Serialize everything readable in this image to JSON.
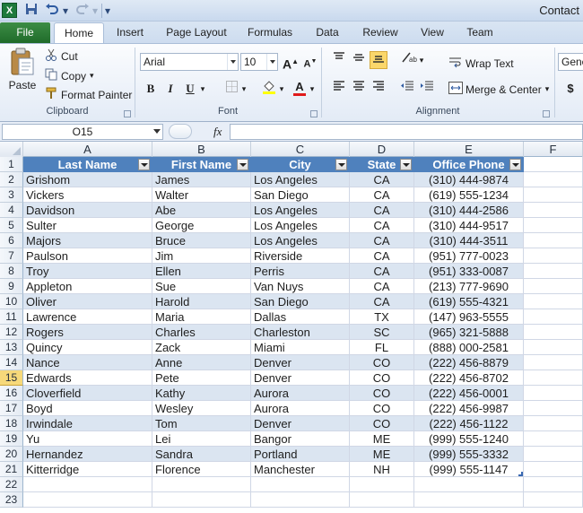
{
  "window": {
    "app_icon": "X",
    "title": "Contact"
  },
  "tabs": [
    "File",
    "Home",
    "Insert",
    "Page Layout",
    "Formulas",
    "Data",
    "Review",
    "View",
    "Team"
  ],
  "ribbon": {
    "clipboard": {
      "paste": "Paste",
      "cut": "Cut",
      "copy": "Copy",
      "format_painter": "Format Painter",
      "label": "Clipboard"
    },
    "font": {
      "name": "Arial",
      "size": "10",
      "bold": "B",
      "italic": "I",
      "underline": "U",
      "grow": "A",
      "shrink": "A",
      "font_color_letter": "A",
      "label": "Font"
    },
    "alignment": {
      "wrap_text": "Wrap Text",
      "merge_center": "Merge & Center",
      "label": "Alignment"
    },
    "number": {
      "format": "Gene",
      "currency": "$"
    }
  },
  "formula_bar": {
    "name_box": "O15",
    "fx": "fx",
    "formula": ""
  },
  "columns": [
    "A",
    "B",
    "C",
    "D",
    "E",
    "F"
  ],
  "row_numbers": [
    "1",
    "2",
    "3",
    "4",
    "5",
    "6",
    "7",
    "8",
    "9",
    "10",
    "11",
    "12",
    "13",
    "14",
    "15",
    "16",
    "17",
    "18",
    "19",
    "20",
    "21",
    "22",
    "23"
  ],
  "selected_row": "15",
  "table": {
    "headers": [
      "Last Name",
      "First Name",
      "City",
      "State",
      "Office Phone"
    ],
    "rows": [
      [
        "Grishom",
        "James",
        "Los Angeles",
        "CA",
        "(310) 444-9874"
      ],
      [
        "Vickers",
        "Walter",
        "San Diego",
        "CA",
        "(619) 555-1234"
      ],
      [
        "Davidson",
        "Abe",
        "Los Angeles",
        "CA",
        "(310) 444-2586"
      ],
      [
        "Sulter",
        "George",
        "Los Angeles",
        "CA",
        "(310) 444-9517"
      ],
      [
        "Majors",
        "Bruce",
        "Los Angeles",
        "CA",
        "(310) 444-3511"
      ],
      [
        "Paulson",
        "Jim",
        "Riverside",
        "CA",
        "(951) 777-0023"
      ],
      [
        "Troy",
        "Ellen",
        "Perris",
        "CA",
        "(951) 333-0087"
      ],
      [
        "Appleton",
        "Sue",
        "Van Nuys",
        "CA",
        "(213) 777-9690"
      ],
      [
        "Oliver",
        "Harold",
        "San Diego",
        "CA",
        "(619) 555-4321"
      ],
      [
        "Lawrence",
        "Maria",
        "Dallas",
        "TX",
        "(147) 963-5555"
      ],
      [
        "Rogers",
        "Charles",
        "Charleston",
        "SC",
        "(965) 321-5888"
      ],
      [
        "Quincy",
        "Zack",
        "Miami",
        "FL",
        "(888) 000-2581"
      ],
      [
        "Nance",
        "Anne",
        "Denver",
        "CO",
        "(222) 456-8879"
      ],
      [
        "Edwards",
        "Pete",
        "Denver",
        "CO",
        "(222) 456-8702"
      ],
      [
        "Cloverfield",
        "Kathy",
        "Aurora",
        "CO",
        "(222) 456-0001"
      ],
      [
        "Boyd",
        "Wesley",
        "Aurora",
        "CO",
        "(222) 456-9987"
      ],
      [
        "Irwindale",
        "Tom",
        "Denver",
        "CO",
        "(222) 456-1122"
      ],
      [
        "Yu",
        "Lei",
        "Bangor",
        "ME",
        "(999) 555-1240"
      ],
      [
        "Hernandez",
        "Sandra",
        "Portland",
        "ME",
        "(999) 555-3332"
      ],
      [
        "Kitterridge",
        "Florence",
        "Manchester",
        "NH",
        "(999) 555-1147"
      ]
    ]
  },
  "colors": {
    "table_header": "#4f81bd",
    "band": "#dbe5f1",
    "file_tab": "#2f7d38",
    "selected_row_header": "#f7d97a"
  }
}
